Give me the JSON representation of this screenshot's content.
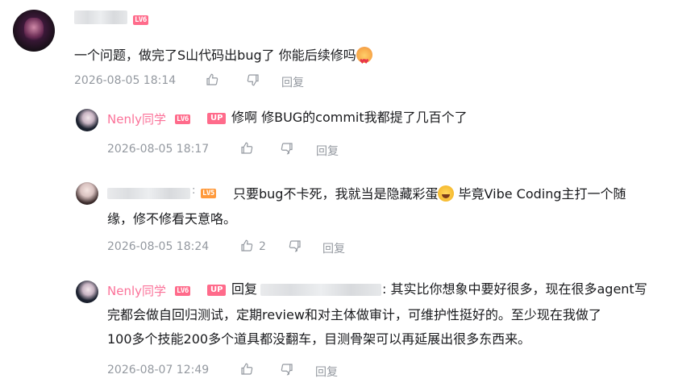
{
  "comments": [
    {
      "text": "一个问题，做完了S山代码出bug了 你能后续修吗",
      "level": "LV6",
      "time": "2026-08-05 18:14",
      "reply_label": "回复"
    },
    {
      "user": "Nenly同学",
      "level": "LV6",
      "badge": "UP",
      "text": "修啊 修BUG的commit我都提了几百个了",
      "time": "2026-08-05 18:17",
      "reply_label": "回复"
    },
    {
      "level": "LV5",
      "text": "只要bug不卡死，我就当是隐藏彩蛋",
      "text_after_emoji": " 毕竟Vibe Coding主打一个随",
      "text_line2": "缘，修不修看天意咯。",
      "time": "2026-08-05 18:24",
      "like_count": "2",
      "reply_label": "回复"
    },
    {
      "user": "Nenly同学",
      "level": "LV6",
      "badge": "UP",
      "reply_prefix": "回复",
      "text_line1": ": 其实比你想象中要好很多，现在很多agent写",
      "text_line2": "完都会做自回归测试，定期review和对主体做审计，可维护性挺好的。至少现在我做了",
      "text_line3": "100多个技能200多个道具都没翻车，目测骨架可以再延展出很多东西来。",
      "time": "2026-08-07 12:49",
      "reply_label": "回复"
    }
  ],
  "colors": {
    "username": "#fb7299",
    "meta": "#9499a0",
    "level6": "#ff6b8b",
    "level5": "#ff9a3c"
  },
  "icons": [
    "thumb-up-icon",
    "thumb-down-icon"
  ]
}
